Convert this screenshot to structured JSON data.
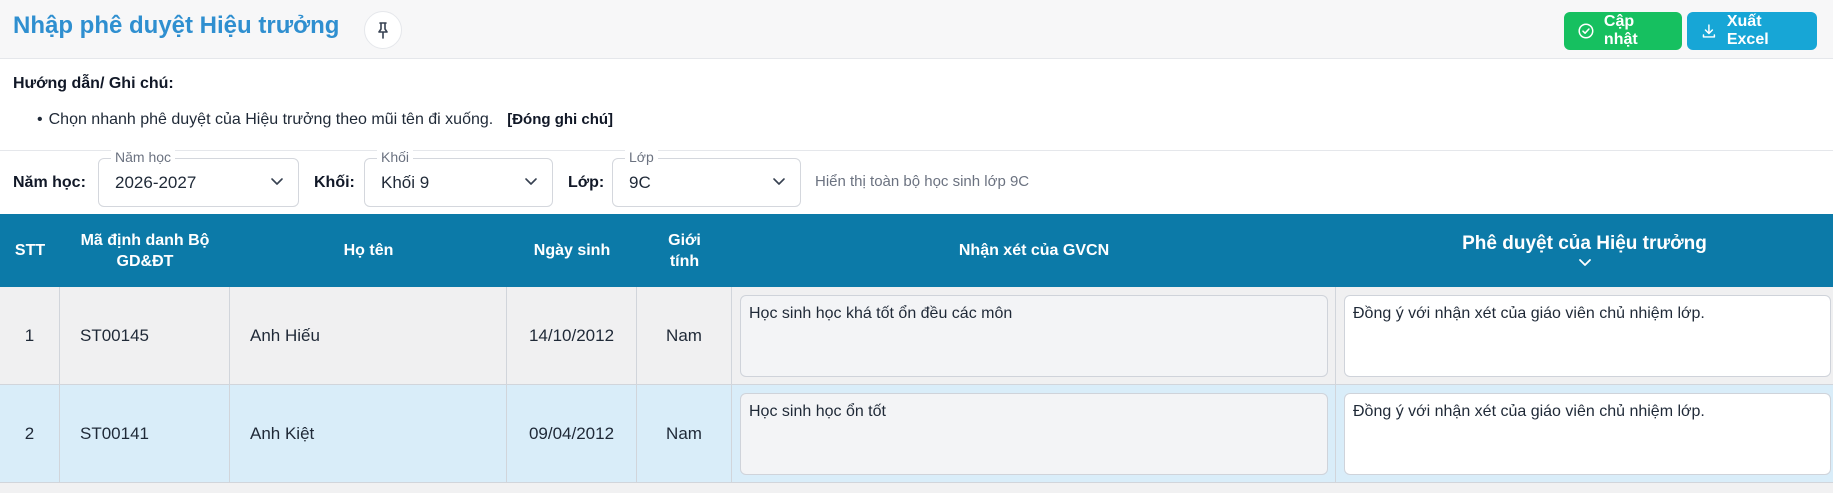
{
  "header": {
    "title": "Nhập phê duyệt Hiệu trưởng",
    "update_label": "Cập nhật",
    "excel_label": "Xuất Excel",
    "accent_blue": "#2f8fd0",
    "update_color": "#16c060",
    "excel_color": "#17a6d6"
  },
  "notes": {
    "title": "Hướng dẫn/ Ghi chú:",
    "bullet": "•",
    "text": "Chọn nhanh phê duyệt của Hiệu trưởng theo mũi tên đi xuống.",
    "close_label": "[Đóng ghi chú]"
  },
  "filters": {
    "year": {
      "label": "Năm học:",
      "legend": "Năm học",
      "value": "2026-2027"
    },
    "grade": {
      "label": "Khối:",
      "legend": "Khối",
      "value": "Khối 9"
    },
    "class": {
      "label": "Lớp:",
      "legend": "Lớp",
      "value": "9C"
    },
    "hint": "Hiển thị toàn bộ học sinh lớp 9C"
  },
  "table": {
    "header_color": "#0c7aa8",
    "columns": {
      "stt": "STT",
      "id": "Mã định danh Bộ GD&ĐT",
      "name": "Họ tên",
      "dob": "Ngày sinh",
      "gender": "Giới tính",
      "comment": "Nhận xét của GVCN",
      "approval": "Phê duyệt của Hiệu trưởng"
    },
    "rows": [
      {
        "stt": "1",
        "id": "ST00145",
        "name": "Anh Hiếu",
        "dob": "14/10/2012",
        "gender": "Nam",
        "comment": "Học sinh học khá tốt ổn đều các môn",
        "approval": "Đồng ý với nhận xét của giáo viên chủ nhiệm lớp."
      },
      {
        "stt": "2",
        "id": "ST00141",
        "name": "Anh Kiệt",
        "dob": "09/04/2012",
        "gender": "Nam",
        "comment": "Học sinh học ổn tốt",
        "approval": "Đồng ý với nhận xét của giáo viên chủ nhiệm lớp."
      }
    ]
  }
}
